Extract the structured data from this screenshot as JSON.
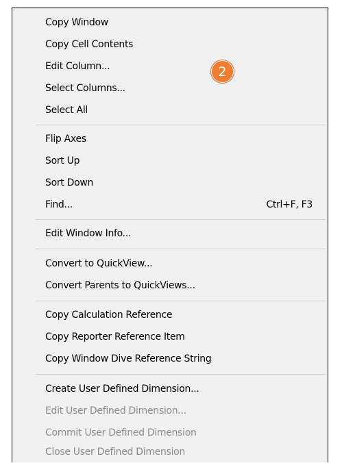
{
  "menu": {
    "items": [
      {
        "label": "Copy Window",
        "shortcut": "",
        "enabled": true
      },
      {
        "label": "Copy Cell Contents",
        "shortcut": "",
        "enabled": true
      },
      {
        "label": "Edit Column...",
        "shortcut": "",
        "enabled": true
      },
      {
        "label": "Select Columns...",
        "shortcut": "",
        "enabled": true
      },
      {
        "label": "Select All",
        "shortcut": "",
        "enabled": true
      },
      {
        "label": "Flip Axes",
        "shortcut": "",
        "enabled": true
      },
      {
        "label": "Sort Up",
        "shortcut": "",
        "enabled": true
      },
      {
        "label": "Sort Down",
        "shortcut": "",
        "enabled": true
      },
      {
        "label": "Find...",
        "shortcut": "Ctrl+F, F3",
        "enabled": true
      },
      {
        "label": "Edit Window Info...",
        "shortcut": "",
        "enabled": true
      },
      {
        "label": "Convert to QuickView...",
        "shortcut": "",
        "enabled": true
      },
      {
        "label": "Convert Parents to QuickViews...",
        "shortcut": "",
        "enabled": true
      },
      {
        "label": "Copy Calculation Reference",
        "shortcut": "",
        "enabled": true
      },
      {
        "label": "Copy Reporter Reference Item",
        "shortcut": "",
        "enabled": true
      },
      {
        "label": "Copy Window Dive Reference String",
        "shortcut": "",
        "enabled": true
      },
      {
        "label": "Create User Defined Dimension...",
        "shortcut": "",
        "enabled": true
      },
      {
        "label": "Edit User Defined Dimension...",
        "shortcut": "",
        "enabled": false
      },
      {
        "label": "Commit User Defined Dimension",
        "shortcut": "",
        "enabled": false
      },
      {
        "label": "Close User Defined Dimension",
        "shortcut": "",
        "enabled": false
      }
    ]
  },
  "callout": {
    "number": "2",
    "color": "#ee7d31"
  }
}
